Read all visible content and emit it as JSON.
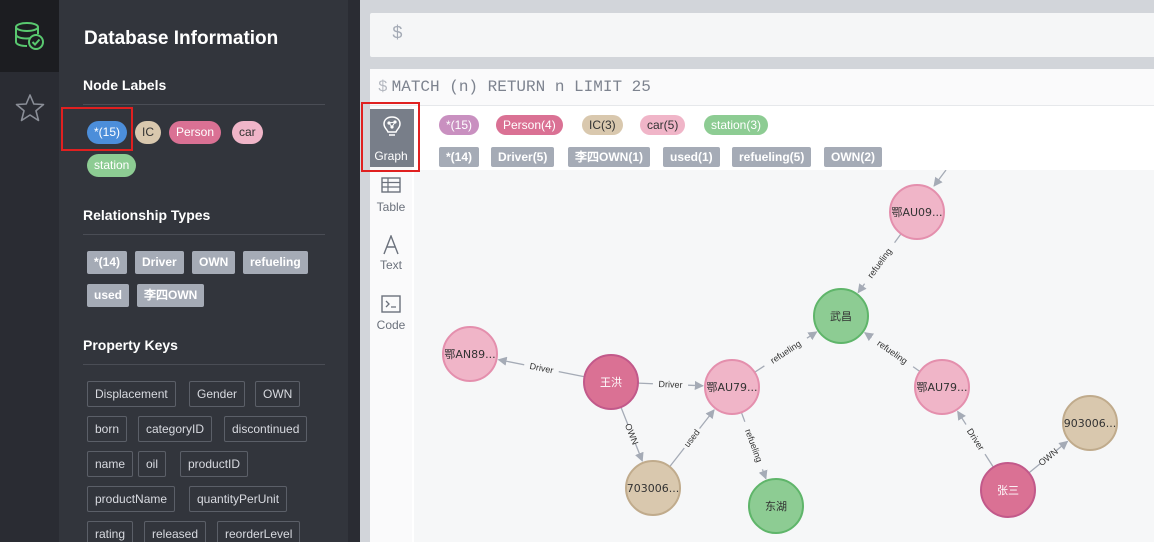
{
  "drawer": {
    "title": "Database Information",
    "node_labels_title": "Node Labels",
    "node_labels": [
      {
        "label": "*(15)",
        "color": "#4c8eda"
      },
      {
        "label": "IC",
        "color": "#d9c8ae"
      },
      {
        "label": "Person",
        "color": "#da7194"
      },
      {
        "label": "car",
        "color": "#f0b5c8"
      },
      {
        "label": "station",
        "color": "#8dcc93"
      }
    ],
    "relationship_types_title": "Relationship Types",
    "relationship_types": [
      "*(14)",
      "Driver",
      "OWN",
      "refueling",
      "used",
      "李四OWN"
    ],
    "property_keys_title": "Property Keys",
    "property_keys": [
      "Displacement",
      "Gender",
      "OWN",
      "born",
      "categoryID",
      "discontinued",
      "name",
      "oil",
      "productID",
      "productName",
      "quantityPerUnit",
      "rating",
      "released",
      "reorderLevel"
    ]
  },
  "editor": {
    "prompt": "$"
  },
  "frame": {
    "prompt": "$",
    "command": "MATCH (n) RETURN n LIMIT 25",
    "view_tabs": [
      "Graph",
      "Table",
      "Text",
      "Code"
    ],
    "result_labels": [
      {
        "label": "*(15)",
        "color": "#c990c0"
      },
      {
        "label": "Person(4)",
        "color": "#da7194"
      },
      {
        "label": "IC(3)",
        "color": "#d9c8ae"
      },
      {
        "label": "car(5)",
        "color": "#f0b5c8"
      },
      {
        "label": "station(3)",
        "color": "#8dcc93"
      }
    ],
    "result_rel_types": [
      "*(14)",
      "Driver(5)",
      "李四OWN(1)",
      "used(1)",
      "refueling(5)",
      "OWN(2)"
    ]
  },
  "graph": {
    "colors": {
      "Person": "#da7194",
      "car": "#f0b5c8",
      "station": "#8dcc93",
      "IC": "#d9c8ae"
    },
    "nodes": [
      {
        "id": "e1",
        "label": "鄂AU09...",
        "type": "car"
      },
      {
        "id": "wc",
        "label": "武昌",
        "type": "station"
      },
      {
        "id": "an",
        "label": "鄂AN89...",
        "type": "car"
      },
      {
        "id": "wh",
        "label": "王洪",
        "type": "Person"
      },
      {
        "id": "e2",
        "label": "鄂AU79...",
        "type": "car"
      },
      {
        "id": "e3",
        "label": "鄂AU79...",
        "type": "car"
      },
      {
        "id": "ic1",
        "label": "703006...",
        "type": "IC"
      },
      {
        "id": "dh",
        "label": "东湖",
        "type": "station"
      },
      {
        "id": "ic2",
        "label": "903006...",
        "type": "IC"
      },
      {
        "id": "zs",
        "label": "张三",
        "type": "Person"
      }
    ],
    "edges": [
      {
        "from": "e1",
        "to": "wc",
        "label": "refueling"
      },
      {
        "from": "wh",
        "to": "an",
        "label": "Driver"
      },
      {
        "from": "wh",
        "to": "e2",
        "label": "Driver"
      },
      {
        "from": "e2",
        "to": "wc",
        "label": "refueling"
      },
      {
        "from": "e3",
        "to": "wc",
        "label": "refueling"
      },
      {
        "from": "wh",
        "to": "ic1",
        "label": "OWN"
      },
      {
        "from": "ic1",
        "to": "e2",
        "label": "used"
      },
      {
        "from": "e2",
        "to": "dh",
        "label": "refueling"
      },
      {
        "from": "zs",
        "to": "e3",
        "label": "Driver"
      },
      {
        "from": "zs",
        "to": "ic2",
        "label": "OWN"
      }
    ]
  }
}
